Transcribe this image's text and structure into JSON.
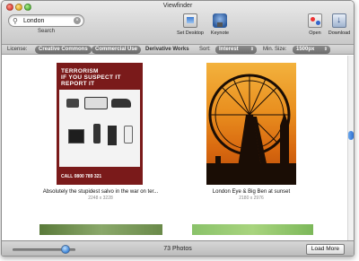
{
  "window": {
    "title": "Viewfinder"
  },
  "toolbar": {
    "search": {
      "value": "London",
      "label": "Search",
      "clear_icon": "clear-icon",
      "icon": "magnifier-icon"
    },
    "buttons": [
      {
        "label": "Set Desktop",
        "icon": "set-desktop-icon"
      },
      {
        "label": "Keynote",
        "icon": "keynote-icon"
      },
      {
        "label": "Open",
        "icon": "open-icon"
      },
      {
        "label": "Download",
        "icon": "download-icon"
      }
    ]
  },
  "filters": {
    "license_label": "License:",
    "license_options": [
      "Creative Commons",
      "Commercial Use",
      "Derivative Works"
    ],
    "sort_label": "Sort:",
    "sort_value": "Interest",
    "min_size_label": "Min. Size:",
    "min_size_value": "1500px"
  },
  "photos": [
    {
      "caption": "Absolutely the stupidest salvo in the war on ter...",
      "dims": "2248 x 3228",
      "poster": {
        "headline": "TERRORISM\nIF YOU SUSPECT IT\nREPORT IT",
        "phone": "CALL 0800 789 321"
      }
    },
    {
      "caption": "London Eye & Big Ben at sunset",
      "dims": "2180 x 2976"
    }
  ],
  "bottom": {
    "count": "73 Photos",
    "load_more": "Load More",
    "zoom_fraction": 0.85
  },
  "colors": {
    "poster_red": "#7a1a1a",
    "sunset_orange": "#e98f1f",
    "accent_blue": "#3a82d6"
  }
}
